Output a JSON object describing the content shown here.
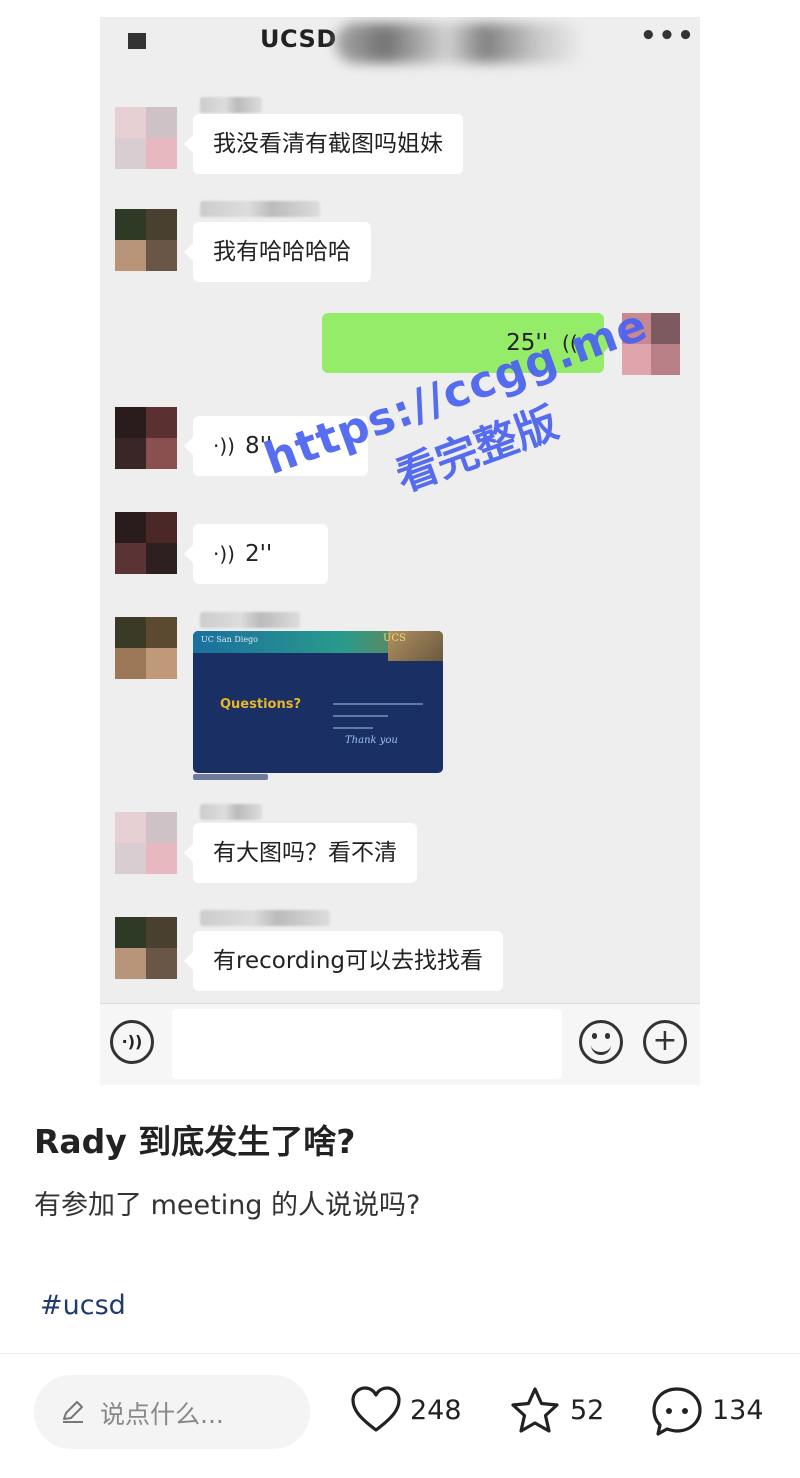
{
  "chat": {
    "title": "UCSD",
    "messages": [
      {
        "type": "text",
        "text": "我没看清有截图吗姐妹"
      },
      {
        "type": "text",
        "text": "我有哈哈哈哈"
      },
      {
        "type": "voice_out",
        "duration": "25''"
      },
      {
        "type": "voice_in",
        "duration": "8''"
      },
      {
        "type": "voice_in",
        "duration": "2''"
      },
      {
        "type": "image"
      },
      {
        "type": "text",
        "text": "有大图吗？看不清"
      },
      {
        "type": "text",
        "text": "有recording可以去找找看"
      }
    ],
    "slide": {
      "header": "UC San Diego",
      "logo": "UCS",
      "heading": "Questions?",
      "closing": "Thank you"
    }
  },
  "watermark": {
    "url": "https://ccgg.me",
    "subtitle": "看完整版"
  },
  "post": {
    "title": "Rady 到底发生了啥?",
    "body": "有参加了 meeting 的人说说吗?",
    "tag": "#ucsd"
  },
  "bottom_bar": {
    "comment_placeholder": "说点什么...",
    "likes": "248",
    "favorites": "52",
    "comments": "134"
  }
}
